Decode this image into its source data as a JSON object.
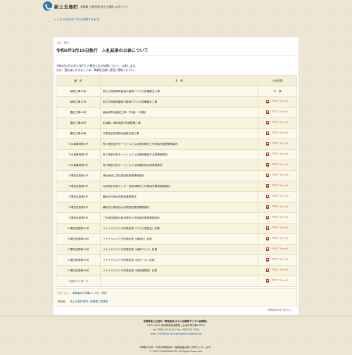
{
  "site": {
    "name": "新上五島町",
    "subtitle": "長崎県 五島列島 新上五島町 公式サイト"
  },
  "mobile_link": "こちらのボタンから印刷できます。",
  "breadcrumb_top": "入札・契約",
  "page_title": "令和6年3月19日執行　入札結果の公表について",
  "intro_lines": [
    "令和6年3月19日に執行した競争入札の結果について、公表します。",
    "なお、落札者におきましては、事業担当課に直接ご連絡ください。"
  ],
  "table": {
    "headers": [
      "番　号",
      "名　称",
      "入札結果"
    ],
    "rows": [
      {
        "num": "総務工事10号",
        "name": "防災行政無線再高過中継局アナログ設備撤去工事",
        "result": "不　調",
        "is_pdf": false
      },
      {
        "num": "総務工事11号",
        "name": "防災行政無線番各中継局アナログ設備撤去工事",
        "result": "ＰＤＦファイル",
        "is_pdf": true
      },
      {
        "num": "建設工事45号",
        "name": "横浜長寿化補修工事（2号機・3号機）",
        "result": "ＰＤＦファイル",
        "is_pdf": true
      },
      {
        "num": "建設工事46号",
        "name": "町道鯛ノ浦阿瀬港2号線整備工事",
        "result": "ＰＤＦファイル",
        "is_pdf": true
      },
      {
        "num": "建設工事48号",
        "name": "今里地区急傾斜地崩壊対策工事",
        "result": "ＰＤＦファイル",
        "is_pdf": true
      },
      {
        "num": "５水道事務第1号",
        "name": "有川港多目的ターミナルビル自家用電気工作物保安管理業務委託",
        "result": "ＰＤＦファイル",
        "is_pdf": true
      },
      {
        "num": "５水道事務第2号",
        "name": "有川港多目的ターミナルビル空調設備保守点検業務委託",
        "result": "ＰＤＦファイル",
        "is_pdf": true
      },
      {
        "num": "５水道事務第3号",
        "name": "有川港多目的ターミナルビル設備定期点検業務委託",
        "result": "ＰＤＦファイル",
        "is_pdf": true
      },
      {
        "num": "５環任民委第1号",
        "name": "浦浜地域し尿処理施設管理業務委託",
        "result": "ＰＤＦファイル",
        "is_pdf": true
      },
      {
        "num": "５環任民委第2号",
        "name": "汚泥再生処理センター自家用電気工作物保安管理業務委託",
        "result": "ＰＤＦファイル",
        "is_pdf": true
      },
      {
        "num": "５環任民委第3号",
        "name": "最終処分場水質検査業務委託",
        "result": "ＰＤＦファイル",
        "is_pdf": true
      },
      {
        "num": "５環任民委第4号",
        "name": "最終処分場浸出水処理施設管理業務委託",
        "result": "ＰＤＦファイル",
        "is_pdf": true
      },
      {
        "num": "５環任民委第5号",
        "name": "ごみ焼却施設自家用電気工作物保安管理業務委託",
        "result": "ＰＤＦファイル",
        "is_pdf": true
      },
      {
        "num": "５環任民物第12号",
        "name": "リサイクルプラザ資源化物（アルミ成型品）処理",
        "result": "ＰＤＦファイル",
        "is_pdf": true
      },
      {
        "num": "５環任民物第13号",
        "name": "リサイクルプラザ資源化物（硝砕缶）処理",
        "result": "ＰＤＦファイル",
        "is_pdf": true
      },
      {
        "num": "５環任民物第14号",
        "name": "リサイクルプラザ資源化物（硝砕アルミ）処理",
        "result": "ＰＤＦファイル",
        "is_pdf": true
      },
      {
        "num": "５環任民物第15号",
        "name": "リサイクルプラザ資源化物（段ボール）処理",
        "result": "ＰＤＦファイル",
        "is_pdf": true
      },
      {
        "num": "５環任民物第16号",
        "name": "リサイクルプラザ資源化物（硝砕国際物）処理",
        "result": "ＰＤＦファイル",
        "is_pdf": true
      },
      {
        "num": "一括ダウンロード",
        "name": "",
        "result": "ＰＤＦファイル",
        "is_pdf": true
      }
    ]
  },
  "category": {
    "label": "カテゴリ：",
    "links": [
      "事業者向け情報",
      "入札・契約"
    ],
    "sep": " > "
  },
  "owner": {
    "label": "発信者：",
    "text": "新上五島町役場 | 総務課 | 監理班"
  },
  "updated": "令和6年03月19日 (火)",
  "footer": {
    "line1": "長崎県新上五島町「管理庶法 みらい拡頼隊デジタル拡頼隊」",
    "line2": "〒857-4495 長崎県南松浦郡新上五島町青方郷1585-1",
    "line3": "tel. 0959-53-1111 / fax. 0959-53-1100",
    "line4_label": "mail.",
    "line4_link": "info@town.shinkamigoto.nagasaki.jp",
    "note1": "※掲載の文書・写真の無断転用・複製転載は固くお断りいたします。",
    "note2": "© 2024 SHINKAMIGOTO All Rights Reserved."
  }
}
